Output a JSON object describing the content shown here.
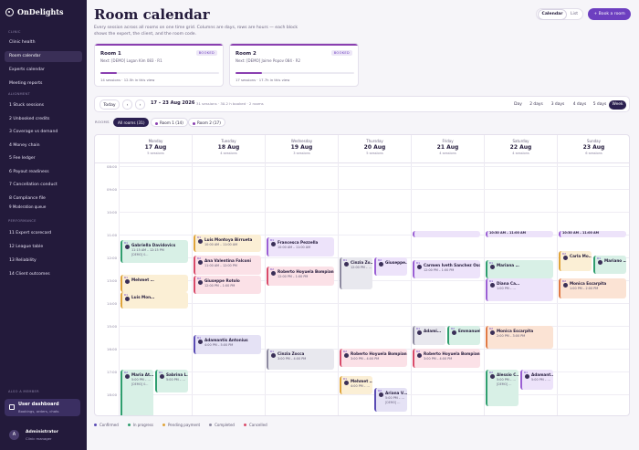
{
  "app": {
    "name": "OnDelights"
  },
  "sidebar": {
    "sections": [
      {
        "title": "CLINIC",
        "items": [
          "Clinic health",
          "Room calendar",
          "Experts calendar",
          "Meeting reports"
        ]
      },
      {
        "title": "ALIGNMENT",
        "items": [
          "1 Stuck sessions",
          "2 Unbooked credits",
          "3 Coverage vs demand",
          "4 Money chain",
          "5 Fee ledger",
          "6 Payout readiness",
          "7 Cancellation conduct",
          "8 Compliance file",
          "9 Moderation queue"
        ]
      },
      {
        "title": "PERFORMANCE",
        "items": [
          "11 Expert scorecard",
          "12 League table",
          "13 Reliability",
          "14 Client outcomes"
        ]
      }
    ],
    "also_member": "ALSO A MEMBER",
    "dashboard": {
      "title": "User dashboard",
      "subtitle": "Bookings, orders, chats"
    },
    "user": {
      "initial": "A",
      "name": "Administrator",
      "role": "Clinic manager"
    }
  },
  "header": {
    "title": "Room calendar",
    "description": "Every session across all rooms on one time grid. Columns are days, rows are hours — each block shows the expert, the client, and the room code.",
    "view_toggle": [
      "Calendar",
      "List"
    ],
    "book_button": "+ Book a room"
  },
  "rooms": [
    {
      "name": "Room 1",
      "badge": "BOOKED",
      "next": "Next: [DEMO] Logan Kim 083 · R1",
      "stats": "14 sessions · 12.5h in this view",
      "fill": 0.14
    },
    {
      "name": "Room 2",
      "badge": "BOOKED",
      "next": "Next: [DEMO] Jaime Popov 084 · R2",
      "stats": "17 sessions · 17.7h in this view",
      "fill": 0.22
    }
  ],
  "toolbar": {
    "today": "Today",
    "prev": "‹",
    "next": "›",
    "range": "17 – 23 Aug 2026",
    "meta": "31 sessions · 30.2 h booked · 2 rooms",
    "views": [
      "Day",
      "2 days",
      "3 days",
      "4 days",
      "5 days",
      "Week"
    ]
  },
  "filters": {
    "label": "ROOMS",
    "chips": [
      "All rooms (31)",
      "Room 1 (14)",
      "Room 2 (17)"
    ]
  },
  "days": [
    {
      "name": "Monday",
      "date": "17 Aug",
      "count": "5 sessions"
    },
    {
      "name": "Tuesday",
      "date": "18 Aug",
      "count": "4 sessions"
    },
    {
      "name": "Wednesday",
      "date": "19 Aug",
      "count": "3 sessions"
    },
    {
      "name": "Thursday",
      "date": "20 Aug",
      "count": "5 sessions"
    },
    {
      "name": "Friday",
      "date": "21 Aug",
      "count": "4 sessions"
    },
    {
      "name": "Saturday",
      "date": "22 Aug",
      "count": "4 sessions"
    },
    {
      "name": "Sunday",
      "date": "23 Aug",
      "count": "6 sessions"
    }
  ],
  "hours": [
    "08:00",
    "09:00",
    "10:00",
    "11:00",
    "12:00",
    "13:00",
    "14:00",
    "15:00",
    "16:00",
    "17:00",
    "18:00"
  ],
  "events": [
    {
      "day": 0,
      "start": 11.25,
      "end": 12.25,
      "status": "progress",
      "room": "R1",
      "name": "Gabriella Davidovics",
      "time": "11:15 AM – 12:15 PM",
      "demo": "[DEMO] 0…"
    },
    {
      "day": 0,
      "start": 12.75,
      "end": 13.5,
      "status": "pending",
      "room": "R1",
      "name": "Mehmet …",
      "time": "",
      "demo": ""
    },
    {
      "day": 0,
      "start": 13.5,
      "end": 14.25,
      "status": "pending",
      "room": "R1",
      "name": "Luis Mon…",
      "time": "",
      "demo": ""
    },
    {
      "day": 0,
      "start": 16.9,
      "end": 20.5,
      "status": "progress",
      "room": "R2",
      "name": "Maria At…",
      "time": "5:00 PM – …",
      "demo": "[DEMO] 0…"
    },
    {
      "day": 0,
      "start": 16.9,
      "end": 17.9,
      "status": "progress",
      "room": "R1",
      "name": "Sabrina L…",
      "time": "5:00 PM – …",
      "demo": ""
    },
    {
      "day": 1,
      "start": 11.0,
      "end": 11.75,
      "status": "pending",
      "room": "R1",
      "name": "Luis Montoya Birrueta",
      "time": "10:00 AM – 11:00 AM",
      "demo": ""
    },
    {
      "day": 1,
      "start": 11.9,
      "end": 12.75,
      "status": "cancelled",
      "room": "R2",
      "name": "Ana Valentina Falconi",
      "time": "11:00 AM – 12:00 PM",
      "demo": ""
    },
    {
      "day": 1,
      "start": 12.8,
      "end": 13.6,
      "status": "cancelled",
      "room": "R2",
      "name": "Giuseppe Rotolo",
      "time": "12:00 PM – 1:00 PM",
      "demo": ""
    },
    {
      "day": 1,
      "start": 15.4,
      "end": 16.25,
      "status": "confirmed",
      "room": "R1",
      "name": "Adamantis Antonius",
      "time": "4:00 PM – 5:00 PM",
      "demo": ""
    },
    {
      "day": 2,
      "start": 11.1,
      "end": 11.95,
      "status": "lav",
      "room": "R1",
      "name": "Francesca Pezzella",
      "time": "10:00 AM – 11:00 AM",
      "demo": ""
    },
    {
      "day": 2,
      "start": 12.4,
      "end": 13.25,
      "status": "cancelled",
      "room": "R2",
      "name": "Roberto Hoyuela Bompiani",
      "time": "12:00 PM – 1:00 PM",
      "demo": ""
    },
    {
      "day": 2,
      "start": 16.0,
      "end": 16.9,
      "status": "completed",
      "room": "R1",
      "name": "Cinzia Zocca",
      "time": "3:00 PM – 4:00 PM",
      "demo": ""
    },
    {
      "day": 3,
      "start": 12.0,
      "end": 13.4,
      "status": "completed",
      "room": "R1",
      "name": "Cinzia Zo…",
      "time": "12:00 PM – …",
      "demo": ""
    },
    {
      "day": 3,
      "start": 12.0,
      "end": 12.8,
      "status": "lav",
      "room": "R2",
      "name": "Giuseppe…",
      "time": "",
      "demo": ""
    },
    {
      "day": 3,
      "start": 16.0,
      "end": 16.8,
      "status": "cancelled",
      "room": "R2",
      "name": "Roberto Hoyuela Bompiani",
      "time": "3:00 PM – 4:00 PM",
      "demo": ""
    },
    {
      "day": 3,
      "start": 17.2,
      "end": 18.0,
      "status": "pending",
      "room": "R1",
      "name": "Mehmet …",
      "time": "4:00 PM – …",
      "demo": ""
    },
    {
      "day": 3,
      "start": 17.7,
      "end": 18.75,
      "status": "confirmed",
      "room": "R2",
      "name": "Ariana V…",
      "time": "5:00 PM – …",
      "demo": "[DEMO] …"
    },
    {
      "day": 4,
      "start": 10.85,
      "end": 11.1,
      "status": "lav",
      "room": "",
      "name": "",
      "time": "",
      "demo": ""
    },
    {
      "day": 4,
      "start": 12.1,
      "end": 12.9,
      "status": "lav",
      "room": "R1",
      "name": "Carmen Iveth Sanchez Osoria",
      "time": "12:00 PM – 1:00 PM",
      "demo": ""
    },
    {
      "day": 4,
      "start": 15.0,
      "end": 15.85,
      "status": "completed",
      "room": "R1",
      "name": "Adami…",
      "time": "",
      "demo": ""
    },
    {
      "day": 4,
      "start": 15.0,
      "end": 15.85,
      "status": "progress",
      "room": "R2",
      "name": "Emmanuel…",
      "time": "",
      "demo": ""
    },
    {
      "day": 4,
      "start": 16.0,
      "end": 16.85,
      "status": "cancelled",
      "room": "R2",
      "name": "Roberto Hoyuela Bompiani",
      "time": "3:00 PM – 4:00 PM",
      "demo": ""
    },
    {
      "day": 5,
      "start": 10.85,
      "end": 11.1,
      "status": "lav",
      "room": "",
      "name": "10:30 AM – 11:00 AM",
      "time": "",
      "demo": ""
    },
    {
      "day": 5,
      "start": 12.1,
      "end": 12.9,
      "status": "progress",
      "room": "R1",
      "name": "Mariana …",
      "time": "",
      "demo": ""
    },
    {
      "day": 5,
      "start": 12.9,
      "end": 13.9,
      "status": "lav",
      "room": "R1",
      "name": "Diana Ca…",
      "time": "1:00 PM – …",
      "demo": ""
    },
    {
      "day": 5,
      "start": 15.0,
      "end": 16.0,
      "status": "room2",
      "room": "R2",
      "name": "Monica Escarpita",
      "time": "2:00 PM – 3:00 PM",
      "demo": ""
    },
    {
      "day": 5,
      "start": 16.9,
      "end": 18.5,
      "status": "progress",
      "room": "R2",
      "name": "Alessio C…",
      "time": "5:00 PM – …",
      "demo": "[DEMO] …"
    },
    {
      "day": 5,
      "start": 16.9,
      "end": 17.8,
      "status": "lav",
      "room": "R1",
      "name": "Adamant…",
      "time": "5:00 PM – …",
      "demo": ""
    },
    {
      "day": 6,
      "start": 10.85,
      "end": 11.1,
      "status": "lav",
      "room": "",
      "name": "10:30 AM – 11:00 AM",
      "time": "",
      "demo": ""
    },
    {
      "day": 6,
      "start": 11.7,
      "end": 12.6,
      "status": "pending",
      "room": "R2",
      "name": "Carla Mo…",
      "time": "",
      "demo": ""
    },
    {
      "day": 6,
      "start": 11.9,
      "end": 12.7,
      "status": "progress",
      "room": "R1",
      "name": "Mariano …",
      "time": "",
      "demo": ""
    },
    {
      "day": 6,
      "start": 12.9,
      "end": 13.8,
      "status": "room2",
      "room": "R2",
      "name": "Monica Escarpita",
      "time": "1:00 PM – 2:00 PM",
      "demo": ""
    }
  ],
  "legend": [
    {
      "label": "Confirmed",
      "color": "#5a4bb4"
    },
    {
      "label": "In progress",
      "color": "#2f9e6e"
    },
    {
      "label": "Pending payment",
      "color": "#e0a43a"
    },
    {
      "label": "Completed",
      "color": "#8d8aa0"
    },
    {
      "label": "Cancelled",
      "color": "#d94b6a"
    }
  ]
}
